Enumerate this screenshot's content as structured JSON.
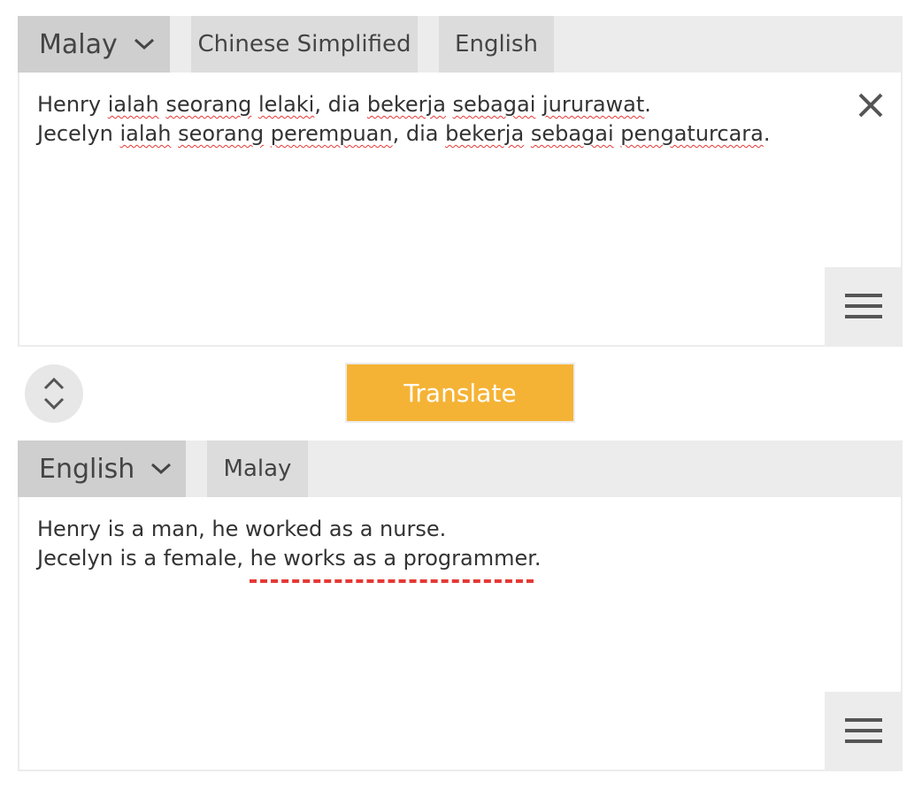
{
  "source": {
    "selected_language": "Malay",
    "language_tabs": [
      "Chinese Simplified",
      "English"
    ],
    "lines": [
      [
        {
          "t": "Henry ",
          "u": false
        },
        {
          "t": "ialah",
          "u": true
        },
        {
          "t": " ",
          "u": false
        },
        {
          "t": "seorang",
          "u": true
        },
        {
          "t": " ",
          "u": false
        },
        {
          "t": "lelaki",
          "u": true
        },
        {
          "t": ", dia ",
          "u": false
        },
        {
          "t": "bekerja",
          "u": true
        },
        {
          "t": " ",
          "u": false
        },
        {
          "t": "sebagai",
          "u": true
        },
        {
          "t": " ",
          "u": false
        },
        {
          "t": "jururawat",
          "u": true
        },
        {
          "t": ".",
          "u": false
        }
      ],
      [
        {
          "t": "Jecelyn ",
          "u": false
        },
        {
          "t": "ialah",
          "u": true
        },
        {
          "t": " ",
          "u": false
        },
        {
          "t": "seorang",
          "u": true
        },
        {
          "t": " ",
          "u": false
        },
        {
          "t": "perempuan",
          "u": true
        },
        {
          "t": ", dia ",
          "u": false
        },
        {
          "t": "bekerja",
          "u": true
        },
        {
          "t": " ",
          "u": false
        },
        {
          "t": "sebagai",
          "u": true
        },
        {
          "t": " ",
          "u": false
        },
        {
          "t": "pengaturcara",
          "u": true
        },
        {
          "t": ".",
          "u": false
        }
      ]
    ],
    "close_icon": "close-icon",
    "menu_icon": "hamburger-menu-icon"
  },
  "controls": {
    "swap_icon": "swap-vertical-icon",
    "translate_label": "Translate",
    "translate_color": "#f5b335"
  },
  "target": {
    "selected_language": "English",
    "language_tabs": [
      "Malay"
    ],
    "lines": [
      [
        {
          "t": "Henry is a man, he worked as a nurse.",
          "u": false
        }
      ],
      [
        {
          "t": "Jecelyn is a female, ",
          "u": false
        },
        {
          "t": "he works as a programmer",
          "g": true
        },
        {
          "t": ".",
          "u": false
        }
      ]
    ],
    "menu_icon": "hamburger-menu-icon"
  },
  "colors": {
    "tab_bar": "#ececec",
    "tab_selected": "#cfcfcf",
    "tab": "#dcdcdc",
    "spellcheck_underline": "#e53935",
    "accent": "#f5b335"
  }
}
